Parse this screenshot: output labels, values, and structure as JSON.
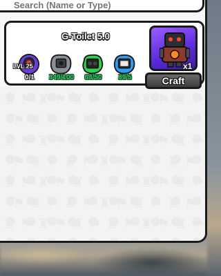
{
  "search": {
    "placeholder": "Search (Name or Type)"
  },
  "craft_item": {
    "title": "G-Toilet 5.0",
    "quantity": "x1",
    "craft_button_label": "Craft",
    "requirements": [
      {
        "name": "level-requirement",
        "level_label": "LVL 25",
        "count": "0/1",
        "color": "#6b3fd6"
      },
      {
        "name": "gray-unit",
        "count": "349/100",
        "color": "#8a8f96"
      },
      {
        "name": "green-unit",
        "count": "63/50",
        "color": "#2fd24a"
      },
      {
        "name": "blue-unit",
        "count": "39/5",
        "color": "#2e9cf2"
      }
    ]
  },
  "colors": {
    "count_ok": "#28d46a",
    "craft_box": "#7b47f0",
    "craft_button": "#4d4d4d"
  }
}
